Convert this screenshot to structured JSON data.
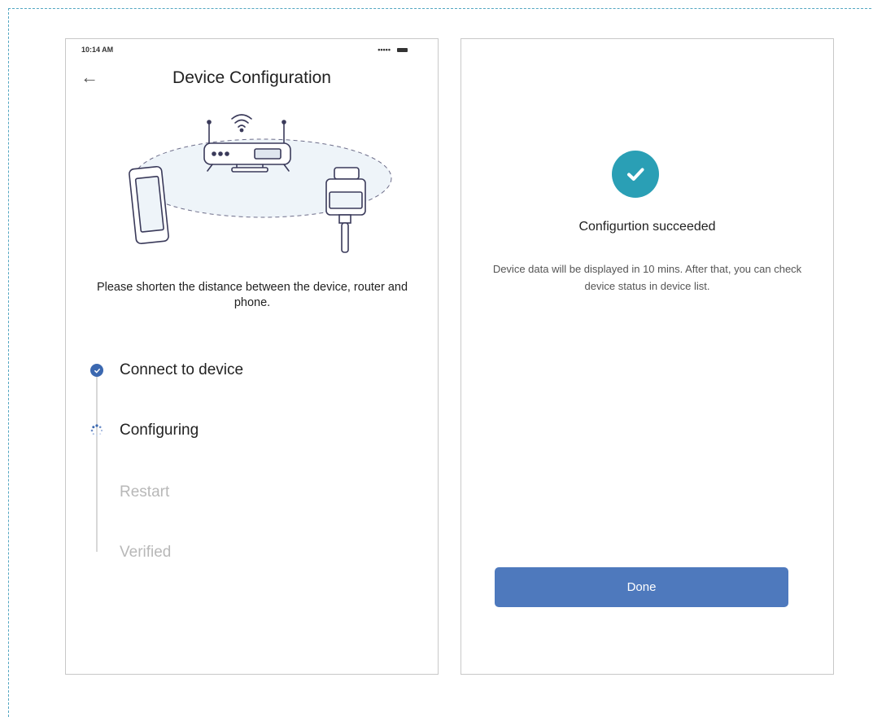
{
  "left_screen": {
    "status_bar": {
      "time": "10:14 AM",
      "signal": "•••••"
    },
    "header": {
      "back_glyph": "←",
      "title": "Device Configuration"
    },
    "hint": "Please shorten the distance between the device, router and phone.",
    "steps": [
      {
        "label": "Connect to device",
        "state": "done"
      },
      {
        "label": "Configuring",
        "state": "in-progress"
      },
      {
        "label": "Restart",
        "state": "pending"
      },
      {
        "label": "Verified",
        "state": "pending"
      }
    ]
  },
  "right_screen": {
    "success_title": "Configurtion succeeded",
    "description": "Device data will be displayed in 10 mins. After that, you can check device status  in device list.",
    "done_label": "Done"
  },
  "colors": {
    "accent": "#4e79bd",
    "success": "#2a9fb5",
    "step_done": "#3b68b0",
    "frame_dash": "#54a7c2"
  },
  "icons": [
    "back-arrow-icon",
    "wifi-router-icon",
    "phone-icon",
    "sensor-device-icon",
    "check-circle-icon",
    "spinner-icon"
  ]
}
